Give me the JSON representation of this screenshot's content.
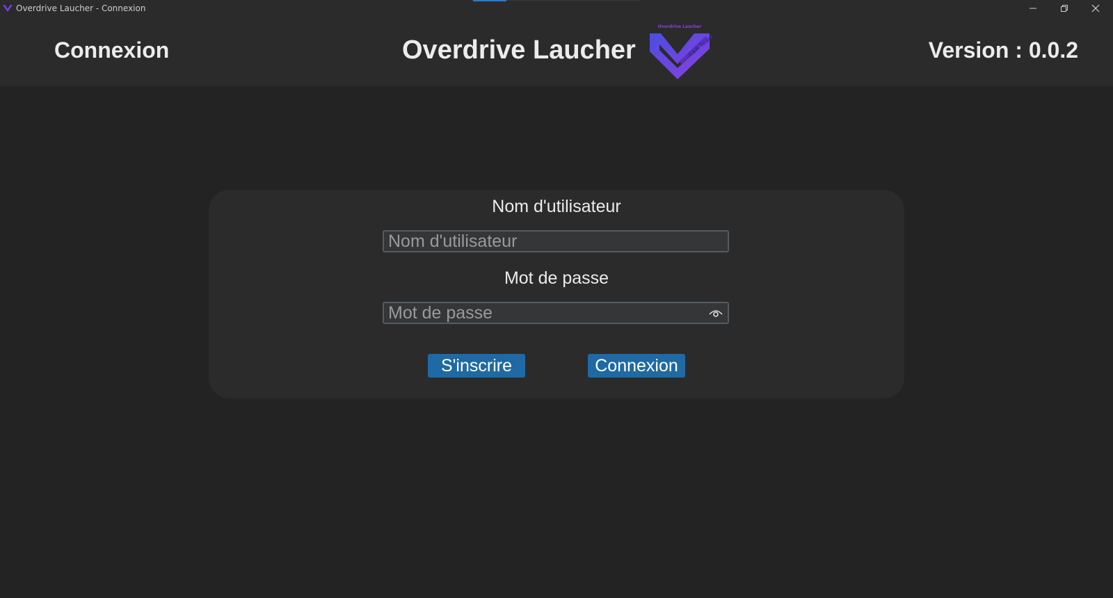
{
  "window": {
    "title": "Overdrive Laucher - Connexion",
    "controls": {
      "minimize_icon": "minimize-icon",
      "maximize_icon": "restore-icon",
      "close_icon": "close-icon"
    }
  },
  "header": {
    "page_title": "Connexion",
    "app_name": "Overdrive Laucher",
    "logo_caption": "Overdrive Laucher",
    "logo_text": "KSR Team",
    "version": "Version : 0.0.2"
  },
  "form": {
    "username_label": "Nom d'utilisateur",
    "username_placeholder": "Nom d'utilisateur",
    "username_value": "",
    "password_label": "Mot de passe",
    "password_placeholder": "Mot de passe",
    "password_value": "",
    "show_password_icon": "eye-icon",
    "register_label": "S'inscrire",
    "login_label": "Connexion"
  },
  "colors": {
    "background": "#232323",
    "header_bg": "#2b2b2b",
    "card_bg": "#2b2b2b",
    "button_blue": "#1f6aa5",
    "logo_purple": "#7b3fe4",
    "logo_blue": "#4a4ee0"
  }
}
